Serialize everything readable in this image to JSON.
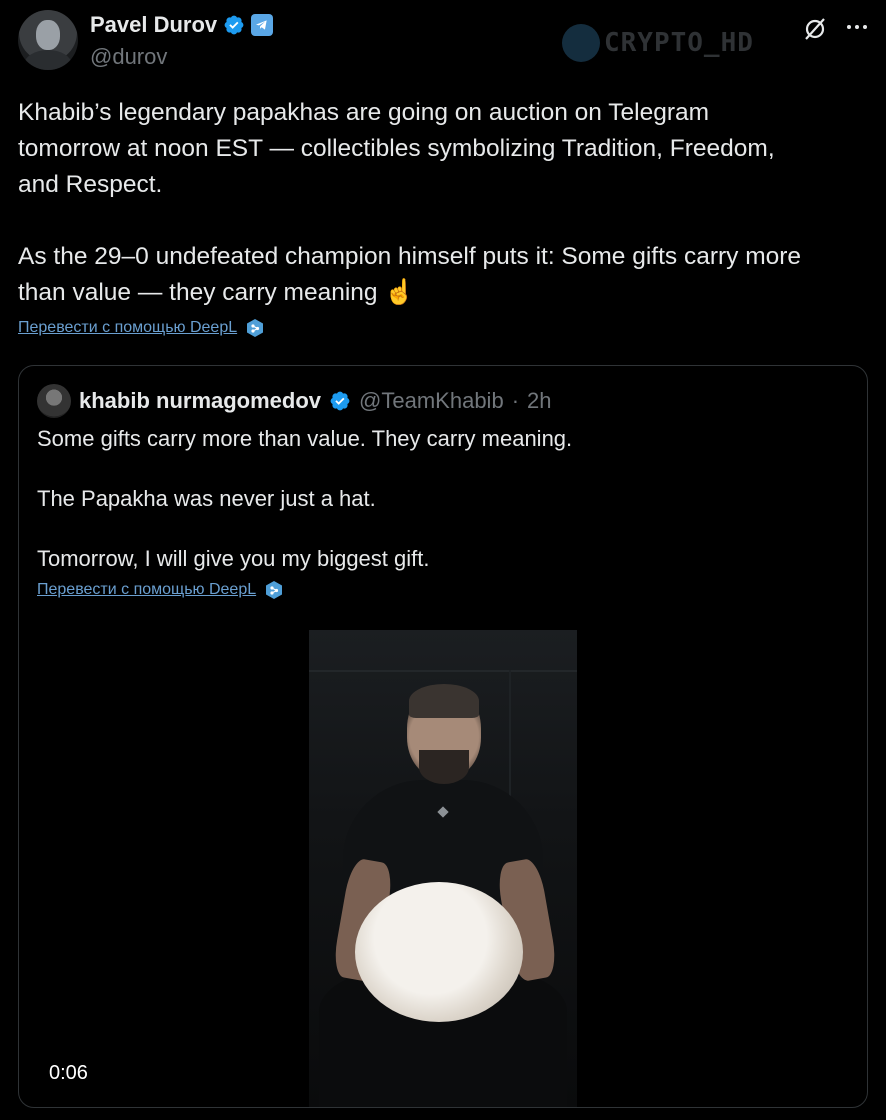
{
  "author": {
    "display_name": "Pavel Durov",
    "handle": "@durov",
    "badges": [
      "verified-icon",
      "telegram-icon"
    ]
  },
  "watermark": "CRYPTO_HD",
  "header_actions": [
    "grok-icon",
    "more-icon"
  ],
  "tweet": {
    "text": "Khabib’s legendary papakhas are going on auction on Telegram\ntomorrow at noon EST — collectibles symbolizing Tradition, Freedom,\nand Respect.\n\nAs the 29–0 undefeated champion himself puts it: Some gifts carry more\nthan value — they carry meaning ☝️",
    "translate_label": "Перевести с помощью DeepL"
  },
  "quoted": {
    "display_name": "khabib nurmagomedov",
    "handle": "@TeamKhabib",
    "separator": "·",
    "time": "2h",
    "text": "Some gifts carry more than value. They carry meaning.\n\nThe Papakha was never just a hat.\n\nTomorrow, I will give you my biggest gift.",
    "translate_label": "Перевести с помощью DeepL",
    "video": {
      "timestamp": "0:06"
    }
  },
  "colors": {
    "background": "#000000",
    "text": "#e7e9ea",
    "muted": "#71767b",
    "link": "#6a9fd0",
    "verified": "#1d9bf0",
    "border": "#2f3336"
  }
}
